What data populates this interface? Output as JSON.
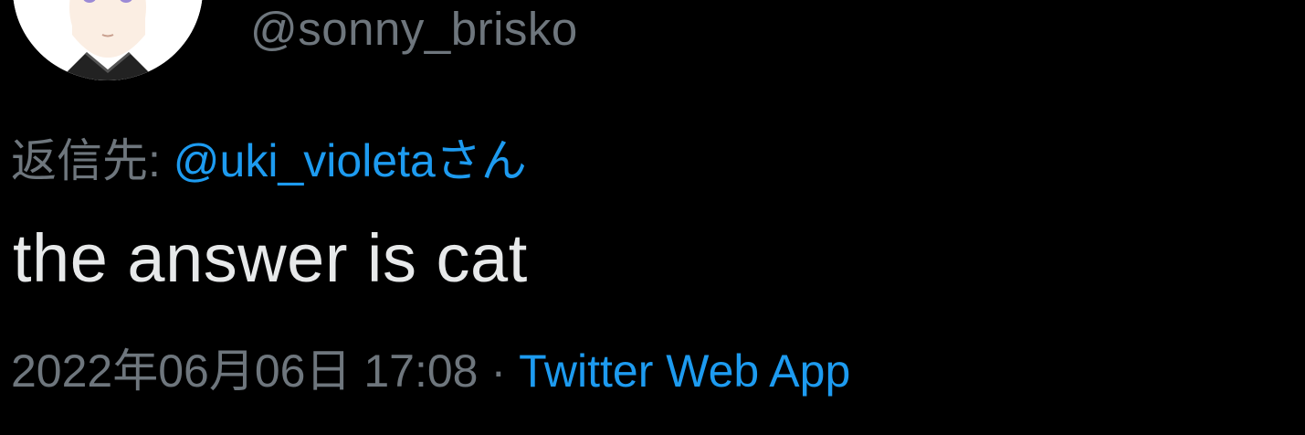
{
  "author": {
    "handle": "@sonny_brisko"
  },
  "reply": {
    "prefix": "返信先: ",
    "mention": "@uki_violeta",
    "suffix": "さん"
  },
  "tweet": {
    "text": "the answer is cat"
  },
  "meta": {
    "timestamp": "2022年06月06日 17:08",
    "separator": "·",
    "source": "Twitter Web App"
  },
  "colors": {
    "background": "#000000",
    "secondary_text": "#6e767d",
    "primary_text": "#e7e9ea",
    "link": "#1d9bf0"
  }
}
